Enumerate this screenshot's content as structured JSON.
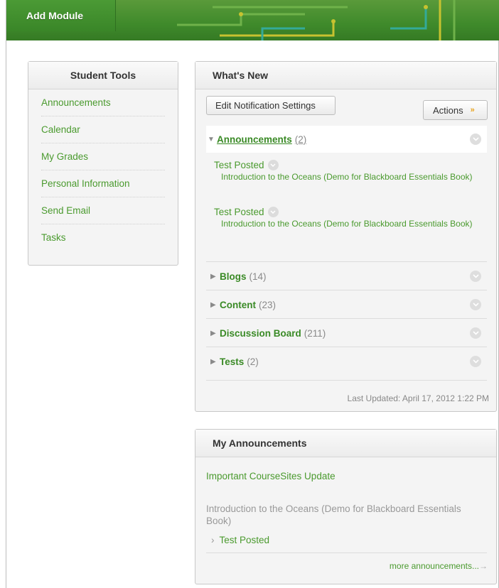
{
  "topbar": {
    "add_module_label": "Add Module"
  },
  "student_tools": {
    "title": "Student Tools",
    "items": [
      {
        "label": "Announcements"
      },
      {
        "label": "Calendar"
      },
      {
        "label": "My Grades"
      },
      {
        "label": "Personal Information"
      },
      {
        "label": "Send Email"
      },
      {
        "label": "Tasks"
      }
    ]
  },
  "whats_new": {
    "title": "What's New",
    "edit_button": "Edit Notification Settings",
    "actions_button": "Actions",
    "announcements": {
      "label": "Announcements",
      "count": "(2)",
      "notices": [
        {
          "title": "Test Posted",
          "course": "Introduction to the Oceans (Demo for Blackboard Essentials Book)"
        },
        {
          "title": "Test Posted",
          "course": "Introduction to the Oceans (Demo for Blackboard Essentials Book)"
        }
      ]
    },
    "sections": [
      {
        "label": "Blogs",
        "count": "(14)"
      },
      {
        "label": "Content",
        "count": "(23)"
      },
      {
        "label": "Discussion Board",
        "count": "(211)"
      },
      {
        "label": "Tests",
        "count": "(2)"
      }
    ],
    "last_updated": "Last Updated: April 17, 2012 1:22 PM"
  },
  "my_announcements": {
    "title": "My Announcements",
    "important": "Important CourseSites Update",
    "course": "Introduction to the Oceans (Demo for Blackboard Essentials Book)",
    "item": "Test Posted",
    "more": "more announcements..."
  },
  "colors": {
    "brand_green": "#3f8a2b",
    "link_green": "#4a9a2e",
    "accent_orange": "#e8a21a"
  }
}
